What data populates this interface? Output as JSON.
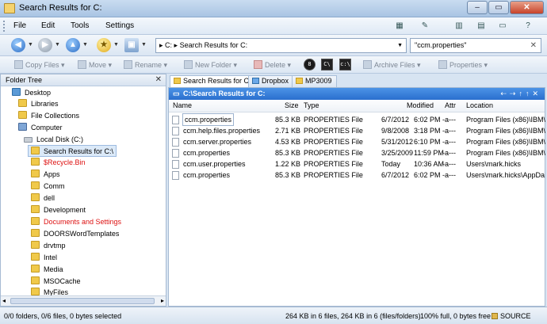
{
  "window": {
    "title": "Search Results for C:",
    "buttons": [
      "–",
      "▭",
      "✕"
    ]
  },
  "menu": {
    "items": [
      "File",
      "Edit",
      "Tools",
      "Settings"
    ]
  },
  "address": {
    "path_root": "C:",
    "path_leaf": "Search Results for C:",
    "search_value": "\"ccm.properties\""
  },
  "toolbar": {
    "copy": "Copy Files",
    "move": "Move",
    "rename": "Rename",
    "new_folder": "New Folder",
    "delete": "Delete",
    "archive": "Archive Files",
    "properties": "Properties"
  },
  "folder_tree": {
    "title": "Folder Tree",
    "items": [
      {
        "label": "Desktop"
      },
      {
        "label": "Libraries"
      },
      {
        "label": "File Collections"
      },
      {
        "label": "Computer"
      },
      {
        "label": "Local Disk (C:)"
      },
      {
        "label": "Search Results for C:\\"
      },
      {
        "label": "$Recycle.Bin"
      },
      {
        "label": "Apps"
      },
      {
        "label": "Comm"
      },
      {
        "label": "dell"
      },
      {
        "label": "Development"
      },
      {
        "label": "Documents and Settings"
      },
      {
        "label": "DOORSWordTemplates"
      },
      {
        "label": "drvtmp"
      },
      {
        "label": "Intel"
      },
      {
        "label": "Media"
      },
      {
        "label": "MSOCache"
      },
      {
        "label": "MyFiles"
      }
    ]
  },
  "tabs": [
    {
      "label": "Search Results for C:"
    },
    {
      "label": "Dropbox"
    },
    {
      "label": "MP3009"
    }
  ],
  "file_pane": {
    "path": "C:\\Search Results for C:",
    "columns": {
      "name": "Name",
      "size": "Size",
      "type": "Type",
      "modified": "Modified",
      "attr": "Attr",
      "location": "Location"
    },
    "rows": [
      {
        "name": "ccm.properties",
        "size": "85.3 KB",
        "type": "PROPERTIES File",
        "date": "6/7/2012",
        "time": "6:02 PM",
        "attr": "-a---",
        "location": "Program Files (x86)\\IBM\\"
      },
      {
        "name": "ccm.help.files.properties",
        "size": "2.71 KB",
        "type": "PROPERTIES File",
        "date": "9/8/2008",
        "time": "3:18 PM",
        "attr": "-a---",
        "location": "Program Files (x86)\\IBM\\"
      },
      {
        "name": "ccm.server.properties",
        "size": "4.53 KB",
        "type": "PROPERTIES File",
        "date": "5/31/2012",
        "time": "6:10 PM",
        "attr": "-a---",
        "location": "Program Files (x86)\\IBM\\"
      },
      {
        "name": "ccm.properties",
        "size": "85.3 KB",
        "type": "PROPERTIES File",
        "date": "3/25/2009",
        "time": "11:59 PM",
        "attr": "-a---",
        "location": "Program Files (x86)\\IBM\\"
      },
      {
        "name": "ccm.user.properties",
        "size": "1.22 KB",
        "type": "PROPERTIES File",
        "date": "Today",
        "time": "10:36 AM",
        "attr": "-a---",
        "location": "Users\\mark.hicks"
      },
      {
        "name": "ccm.properties",
        "size": "85.3 KB",
        "type": "PROPERTIES File",
        "date": "6/7/2012",
        "time": "6:02 PM",
        "attr": "-a---",
        "location": "Users\\mark.hicks\\AppDa"
      }
    ]
  },
  "status": {
    "left": "0/0 folders, 0/6 files, 0 bytes selected",
    "mid": "264 KB in 6 files,  264 KB in 6 (files/folders)",
    "right": "100% full, 0 bytes free",
    "source": "SOURCE"
  }
}
